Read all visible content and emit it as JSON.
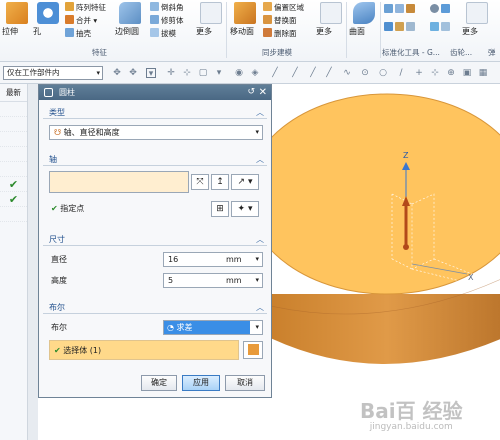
{
  "ribbon": {
    "big": [
      {
        "label": "拉伸"
      },
      {
        "label": "孔"
      },
      {
        "label": "边倒圆"
      },
      {
        "label": "更多"
      },
      {
        "label": "移动面"
      },
      {
        "label": "更多"
      },
      {
        "label": "曲面"
      },
      {
        "label": "更多"
      }
    ],
    "small": [
      {
        "label": "阵列特征"
      },
      {
        "label": "合并 ▾"
      },
      {
        "label": "抽壳"
      },
      {
        "label": "倒斜角"
      },
      {
        "label": "修剪体"
      },
      {
        "label": "拔模"
      },
      {
        "label": "偏置区域"
      },
      {
        "label": "替换面"
      },
      {
        "label": "删除面"
      }
    ],
    "groups": [
      {
        "label": "特征"
      },
      {
        "label": "同步建模"
      },
      {
        "label": "标准化工具 - G..."
      },
      {
        "label": "齿轮..."
      },
      {
        "label": "弹"
      }
    ]
  },
  "toolbar": {
    "filter_value": "仅在工作部件内"
  },
  "navigator": {
    "header": "最新"
  },
  "dialog": {
    "title": "圆柱",
    "sections": {
      "type": {
        "label": "类型",
        "value": "轴、直径和高度"
      },
      "axis": {
        "label": "轴",
        "point_label": "指定点"
      },
      "dims": {
        "label": "尺寸",
        "diameter_label": "直径",
        "diameter_value": "16",
        "diameter_unit": "mm",
        "height_label": "高度",
        "height_value": "5",
        "height_unit": "mm"
      },
      "boolean": {
        "label": "布尔",
        "field_label": "布尔",
        "value": "求差",
        "select_body": "选择体 (1)"
      }
    },
    "buttons": {
      "ok": "确定",
      "apply": "应用",
      "cancel": "取消"
    }
  },
  "viewport": {
    "axis_z": "Z",
    "axis_x": "X"
  },
  "watermark": {
    "text": "Bai百 经验",
    "sub": "jingyan.baidu.com"
  }
}
